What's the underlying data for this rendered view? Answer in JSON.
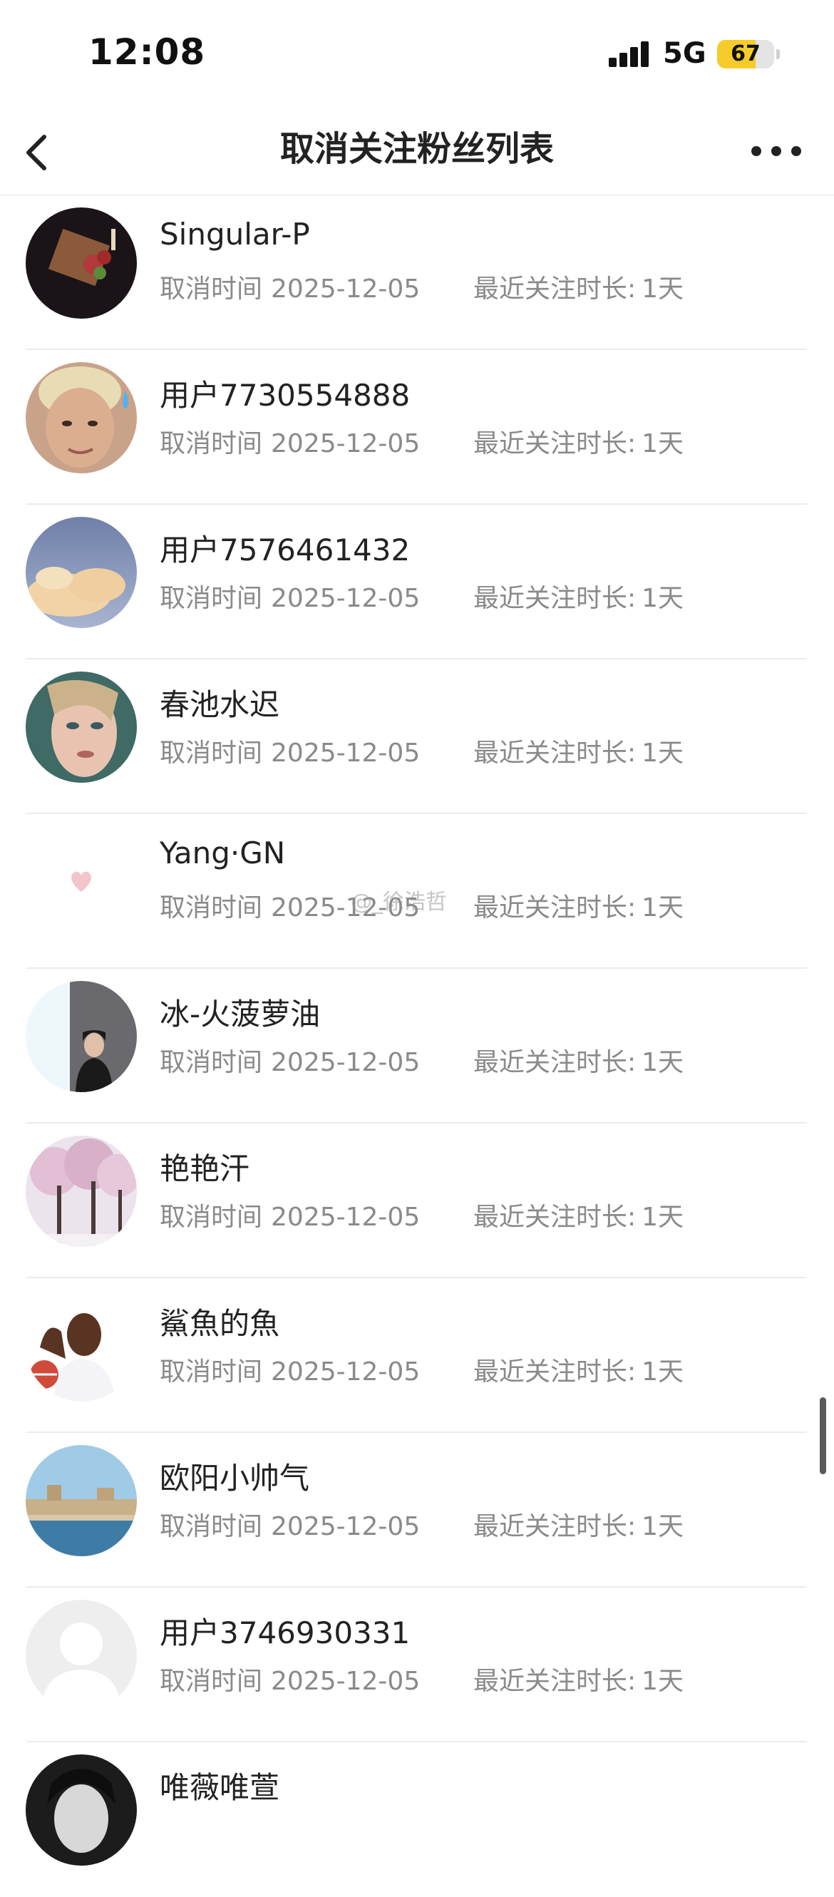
{
  "status_bar": {
    "time": "12:08",
    "network": "5G",
    "battery": "67",
    "battery_level": 0.67,
    "battery_color": "#f5cc2a"
  },
  "nav": {
    "title": "取消关注粉丝列表",
    "back_icon": "chevron-left-icon",
    "more_icon": "more-dots-icon"
  },
  "labels": {
    "cancel_time": "取消时间",
    "recent_follow_duration": "最近关注时长:"
  },
  "watermark": "@_徐浩哲",
  "users": [
    {
      "name": "Singular-P",
      "cancel_date": "2025-12-05",
      "duration": "1天",
      "avatar": "flower-bouquet-avatar"
    },
    {
      "name": "用户7730554888",
      "cancel_date": "2025-12-05",
      "duration": "1天",
      "avatar": "face-sweat-avatar"
    },
    {
      "name": "用户7576461432",
      "cancel_date": "2025-12-05",
      "duration": "1天",
      "avatar": "cloud-sky-avatar"
    },
    {
      "name": "春池水迟",
      "cancel_date": "2025-12-05",
      "duration": "1天",
      "avatar": "woman-portrait-avatar"
    },
    {
      "name": "Yang·GN",
      "cancel_date": "2025-12-05",
      "duration": "1天",
      "avatar": "pink-heart-avatar"
    },
    {
      "name": "冰-火菠萝油",
      "cancel_date": "2025-12-05",
      "duration": "1天",
      "avatar": "person-dark-avatar"
    },
    {
      "name": "艳艳汗",
      "cancel_date": "2025-12-05",
      "duration": "1天",
      "avatar": "cherry-blossom-avatar"
    },
    {
      "name": "鯊魚的魚",
      "cancel_date": "2025-12-05",
      "duration": "1天",
      "avatar": "basketball-player-avatar"
    },
    {
      "name": "欧阳小帅气",
      "cancel_date": "2025-12-05",
      "duration": "1天",
      "avatar": "city-river-avatar"
    },
    {
      "name": "用户3746930331",
      "cancel_date": "2025-12-05",
      "duration": "1天",
      "avatar": "default-user-avatar"
    },
    {
      "name": "唯薇唯萱",
      "cancel_date": "",
      "duration": "",
      "avatar": "woman-bw-avatar"
    }
  ]
}
